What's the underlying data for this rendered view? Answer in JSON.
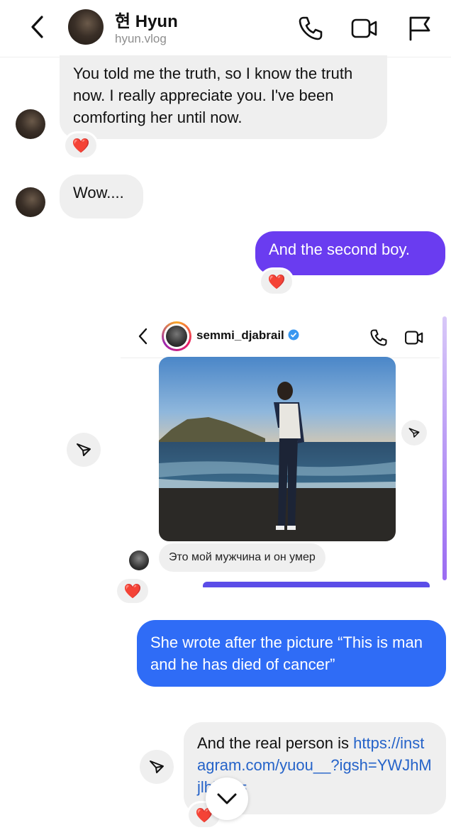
{
  "header": {
    "name": "현 Hyun",
    "username": "hyun.vlog",
    "icons": [
      "back-chevron-icon",
      "phone-icon",
      "video-icon",
      "flag-icon"
    ]
  },
  "messages": {
    "m1": {
      "text": "You told me the truth, so I know the truth now. I really appreciate you. I've been comforting her until now.",
      "reaction": "❤️"
    },
    "m2": {
      "text": "Wow...."
    },
    "m3": {
      "text": "And the second boy.",
      "reaction": "❤️"
    },
    "m4": {
      "embed_username": "semmi_djabrail",
      "caption": "Это мой мужчина и он умер",
      "reaction": "❤️"
    },
    "m5": {
      "text": "She wrote after the picture “This is man and he has died of cancer”"
    },
    "m6": {
      "text": "And the real person is ",
      "link": "https://instagram.com/yuou__?igsh=YWJhMjlhZTc=",
      "reaction": "❤️"
    }
  },
  "colors": {
    "outgoing_purple": "#6a3cf0",
    "outgoing_blue": "#2f6cf6",
    "incoming_gray": "#efefef",
    "link": "#2563c9"
  }
}
